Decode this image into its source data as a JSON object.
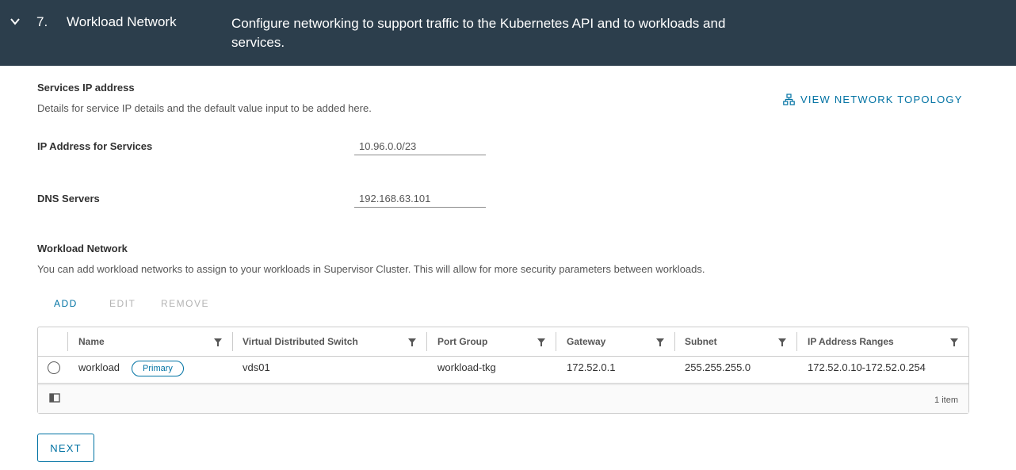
{
  "header": {
    "step_number": "7.",
    "title": "Workload Network",
    "description": "Configure networking to support traffic to the Kubernetes API and to workloads and services."
  },
  "services": {
    "title": "Services IP address",
    "description": "Details for service IP details and the default value input to be added here.",
    "topology_link": "VIEW NETWORK TOPOLOGY",
    "ip_label": "IP Address for Services",
    "ip_value": "10.96.0.0/23",
    "dns_label": "DNS Servers",
    "dns_value": "192.168.63.101"
  },
  "workload": {
    "title": "Workload Network",
    "description": "You can add workload networks to assign to your workloads in Supervisor Cluster. This will allow for more security parameters between workloads.",
    "actions": {
      "add": "ADD",
      "edit": "EDIT",
      "remove": "REMOVE"
    },
    "columns": [
      "Name",
      "Virtual Distributed Switch",
      "Port Group",
      "Gateway",
      "Subnet",
      "IP Address Ranges"
    ],
    "rows": [
      {
        "name": "workload",
        "badge": "Primary",
        "vds": "vds01",
        "port_group": "workload-tkg",
        "gateway": "172.52.0.1",
        "subnet": "255.255.255.0",
        "ip_ranges": "172.52.0.10-172.52.0.254"
      }
    ],
    "footer_count": "1 item"
  },
  "next_button": "NEXT",
  "colors": {
    "header_bg": "#2c3e4c",
    "accent": "#0072a3",
    "disabled": "#b3b3b3"
  },
  "icons": [
    "chevron-down-icon",
    "network-topology-icon",
    "filter-icon",
    "column-toggle-icon"
  ]
}
